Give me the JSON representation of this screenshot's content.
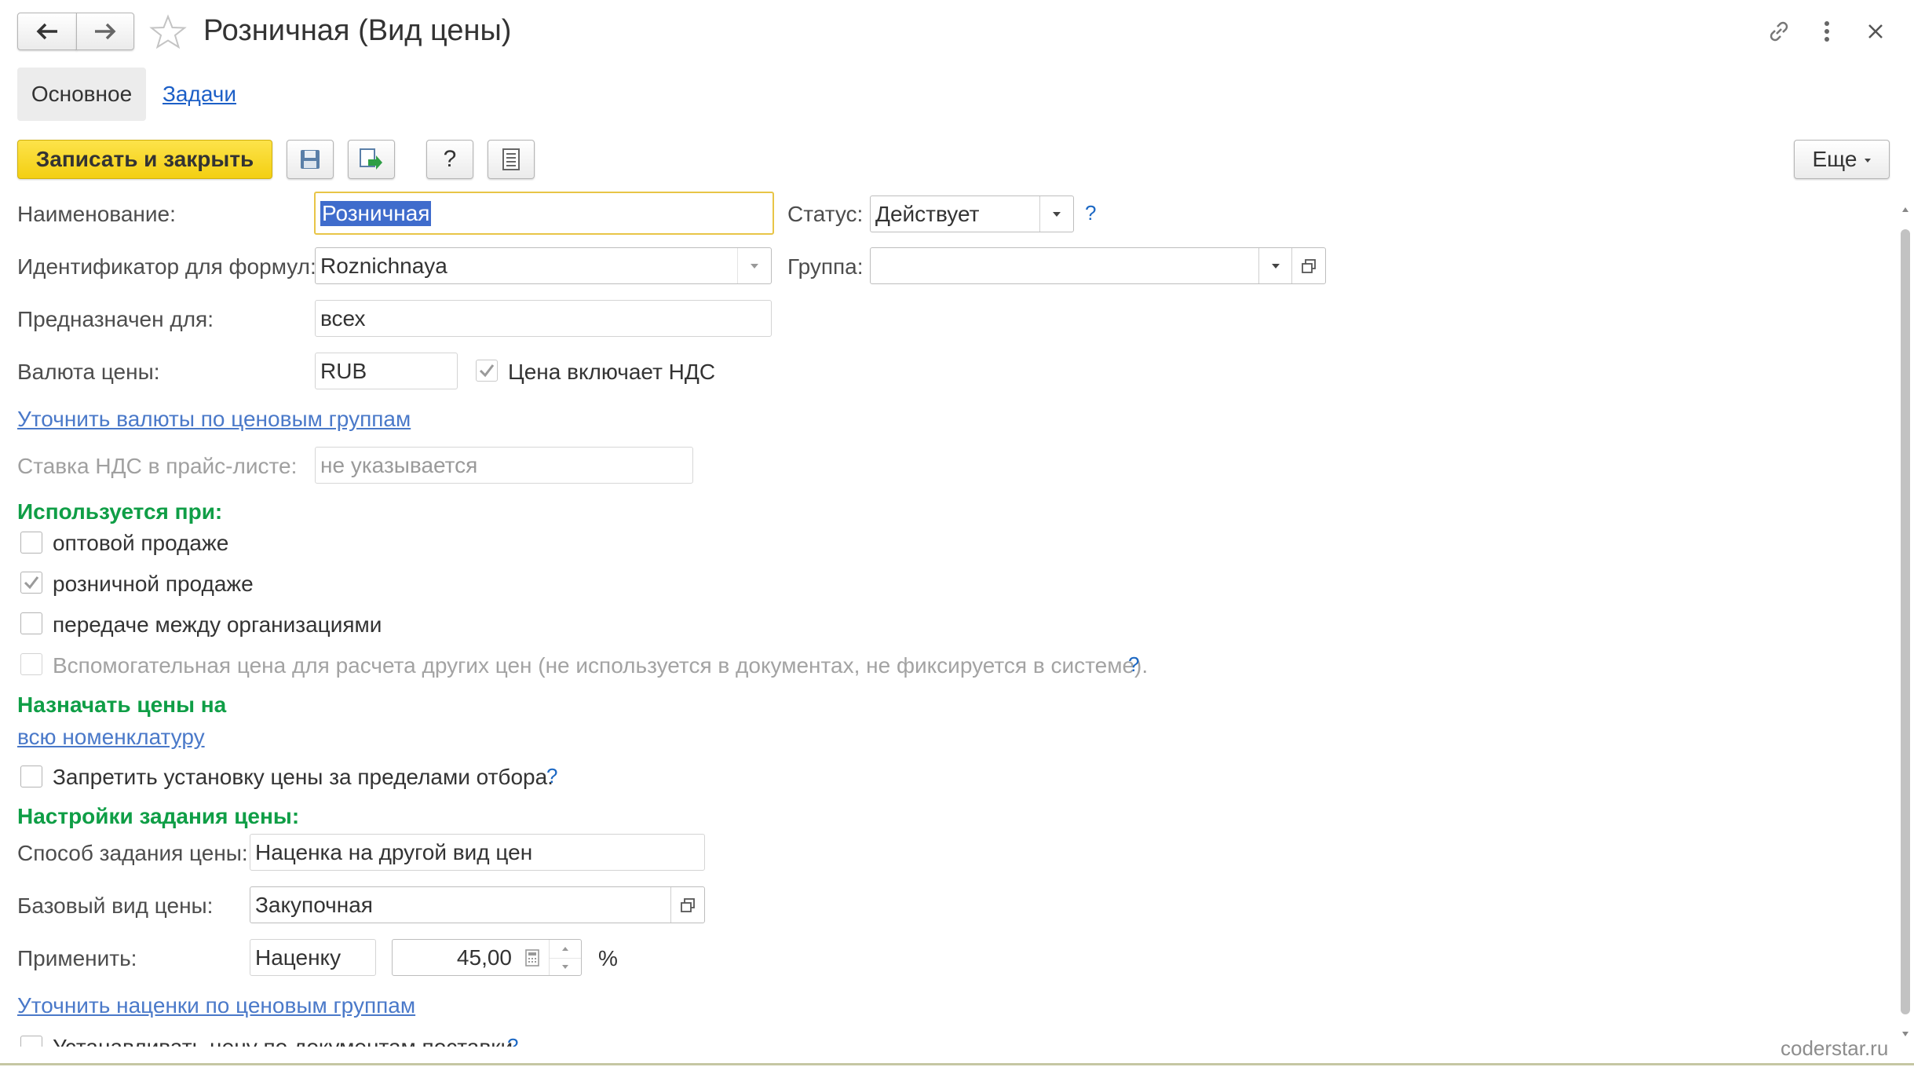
{
  "window": {
    "title": "Розничная (Вид цены)",
    "watermark": "coderstar.ru"
  },
  "tabs": [
    {
      "label": "Основное"
    },
    {
      "label": "Задачи"
    }
  ],
  "toolbar": {
    "save_close_label": "Записать и закрыть",
    "help_label": "?",
    "more_label": "Еще"
  },
  "form": {
    "name": {
      "label": "Наименование:",
      "value": "Розничная"
    },
    "status": {
      "label": "Статус:",
      "value": "Действует",
      "help": "?"
    },
    "formula_id": {
      "label": "Идентификатор для формул:",
      "value": "Roznichnaya"
    },
    "group": {
      "label": "Группа:",
      "value": ""
    },
    "intended_for": {
      "label": "Предназначен для:",
      "value": "всех"
    },
    "currency": {
      "label": "Валюта цены:",
      "value": "RUB"
    },
    "vat_included": {
      "label": "Цена включает НДС",
      "checked": true
    },
    "currency_link": "Уточнить валюты по ценовым группам",
    "vat_rate": {
      "label": "Ставка НДС в прайс-листе:",
      "placeholder": "не указывается"
    }
  },
  "used_in": {
    "heading": "Используется при:",
    "items": [
      {
        "label": "оптовой продаже",
        "checked": false
      },
      {
        "label": "розничной продаже",
        "checked": true
      },
      {
        "label": "передаче между организациями",
        "checked": false
      }
    ],
    "auxiliary": {
      "label": "Вспомогательная цена для расчета других цен (не используется в документах, не фиксируется в системе).",
      "checked": false,
      "help": "?"
    }
  },
  "assign": {
    "heading": "Назначать цены на",
    "link": "всю номенклатуру",
    "forbid": {
      "label": "Запретить установку цены за пределами отбора.",
      "checked": false,
      "help": "?"
    }
  },
  "price_settings": {
    "heading": "Настройки задания цены:",
    "method": {
      "label": "Способ задания цены:",
      "value": "Наценка на другой вид цен"
    },
    "base_type": {
      "label": "Базовый вид цены:",
      "value": "Закупочная"
    },
    "apply": {
      "label": "Применить:",
      "mode": "Наценку",
      "amount": "45,00",
      "unit": "%"
    },
    "markup_link": "Уточнить наценки по ценовым группам",
    "delivery_docs": {
      "label": "Устанавливать цену по документам поставки",
      "checked": false,
      "help": "?"
    }
  },
  "colors": {
    "accent_yellow": "#f7d829",
    "section_green": "#0f9e46",
    "link_blue": "#4a79c9",
    "focus_border": "#e8c547",
    "selection": "#3f6ccc"
  }
}
